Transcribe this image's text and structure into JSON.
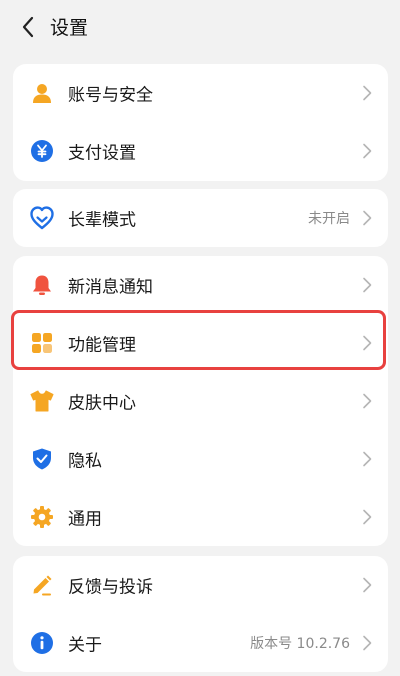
{
  "header": {
    "title": "设置"
  },
  "groups": [
    {
      "items": [
        {
          "label": "账号与安全",
          "icon": "person-icon"
        },
        {
          "label": "支付设置",
          "icon": "yuan-coin-icon"
        }
      ]
    },
    {
      "items": [
        {
          "label": "长辈模式",
          "icon": "heart-shield-icon",
          "value": "未开启"
        }
      ]
    },
    {
      "items": [
        {
          "label": "新消息通知",
          "icon": "bell-icon"
        },
        {
          "label": "功能管理",
          "icon": "grid-icon",
          "highlighted": true
        },
        {
          "label": "皮肤中心",
          "icon": "tshirt-icon"
        },
        {
          "label": "隐私",
          "icon": "shield-check-icon"
        },
        {
          "label": "通用",
          "icon": "gear-icon"
        }
      ]
    },
    {
      "items": [
        {
          "label": "反馈与投诉",
          "icon": "pencil-icon"
        },
        {
          "label": "关于",
          "icon": "info-icon",
          "value": "版本号 10.2.76"
        }
      ]
    }
  ],
  "colors": {
    "background": "#f2f2f2",
    "card": "#ffffff",
    "orange": "#f5a623",
    "blue": "#1f6fe5",
    "red": "#f0533f",
    "highlight": "#e8413f"
  }
}
